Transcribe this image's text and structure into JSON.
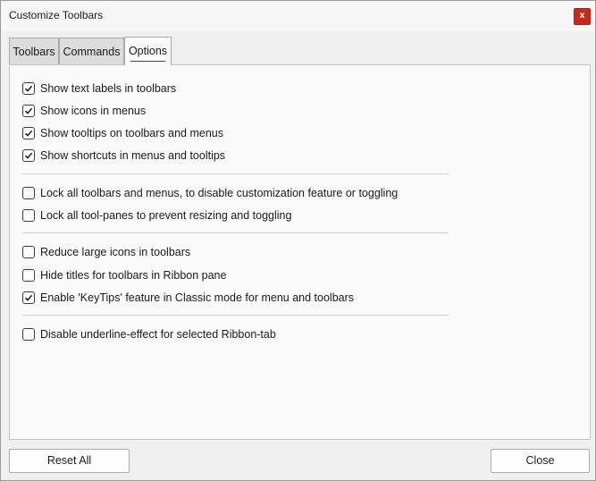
{
  "window": {
    "title": "Customize Toolbars",
    "close_glyph": "x"
  },
  "tabs": [
    {
      "label": "Toolbars",
      "active": false
    },
    {
      "label": "Commands",
      "active": false
    },
    {
      "label": "Options",
      "active": true
    }
  ],
  "options": [
    {
      "label": "Show text labels in toolbars",
      "checked": true
    },
    {
      "label": "Show icons in menus",
      "checked": true
    },
    {
      "label": "Show tooltips on toolbars and menus",
      "checked": true
    },
    {
      "label": "Show shortcuts in menus and tooltips",
      "checked": true
    },
    {
      "label": "Lock all toolbars and menus, to disable customization feature or toggling",
      "checked": false
    },
    {
      "label": "Lock all tool-panes to prevent resizing and toggling",
      "checked": false
    },
    {
      "label": "Reduce large icons in toolbars",
      "checked": false
    },
    {
      "label": "Hide titles for toolbars in Ribbon pane",
      "checked": false
    },
    {
      "label": "Enable 'KeyTips' feature in Classic mode for menu and toolbars",
      "checked": true
    },
    {
      "label": "Disable underline-effect for selected Ribbon-tab",
      "checked": false
    }
  ],
  "buttons": {
    "reset_all": "Reset All",
    "close": "Close"
  },
  "colors": {
    "close_button_bg": "#c42b1c",
    "panel_bg": "#fafafa",
    "window_bg": "#f0f0f0"
  }
}
